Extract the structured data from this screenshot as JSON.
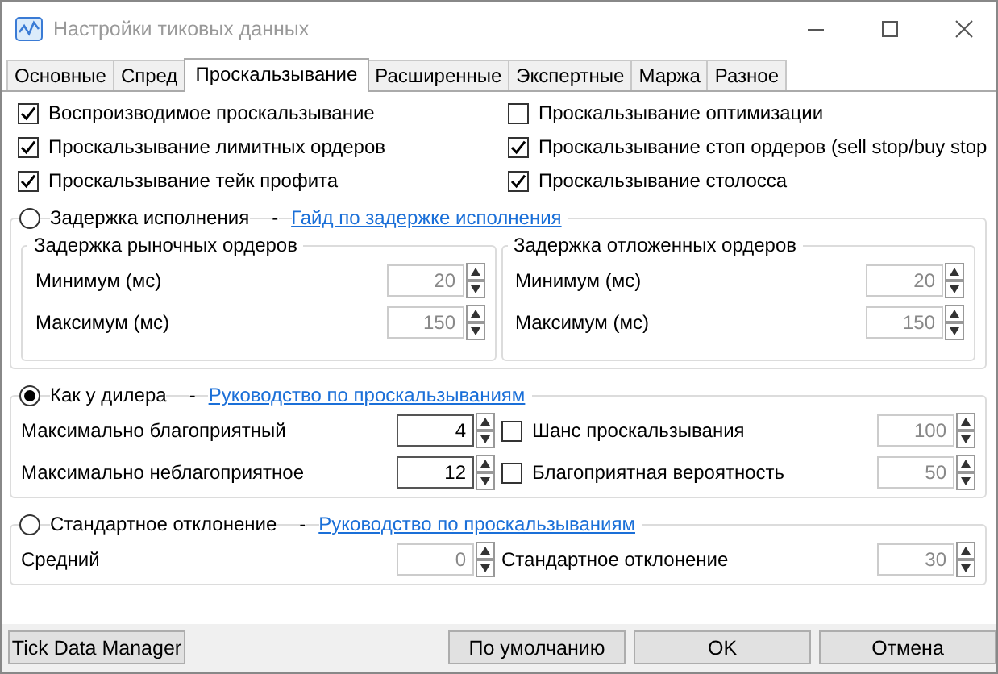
{
  "window": {
    "title": "Настройки тиковых данных"
  },
  "tabs": [
    {
      "label": "Основные",
      "selected": false
    },
    {
      "label": "Спред",
      "selected": false
    },
    {
      "label": "Проскальзывание",
      "selected": true
    },
    {
      "label": "Расширенные",
      "selected": false
    },
    {
      "label": "Экспертные",
      "selected": false
    },
    {
      "label": "Маржа",
      "selected": false
    },
    {
      "label": "Разное",
      "selected": false
    }
  ],
  "options": [
    {
      "label": "Воспроизводимое проскальзывание",
      "checked": true
    },
    {
      "label": "Проскальзывание оптимизации",
      "checked": false
    },
    {
      "label": "Проскальзывание лимитных ордеров",
      "checked": true
    },
    {
      "label": "Проскальзывание стоп ордеров (sell stop/buy stop",
      "checked": true
    },
    {
      "label": "Проскальзывание тейк профита",
      "checked": true
    },
    {
      "label": "Проскальзывание столосса",
      "checked": true
    }
  ],
  "modes": [
    {
      "label": "Задержка исполнения",
      "selected": false,
      "separator": "-",
      "link": "Гайд по задержке исполнения",
      "groups": [
        {
          "title": "Задержка рыночных ордеров",
          "fields": [
            {
              "label": "Минимум (мс)",
              "value": "20",
              "disabled": true
            },
            {
              "label": "Максимум (мс)",
              "value": "150",
              "disabled": true
            }
          ]
        },
        {
          "title": "Задержка отложенных ордеров",
          "fields": [
            {
              "label": "Минимум (мс)",
              "value": "20",
              "disabled": true
            },
            {
              "label": "Максимум (мс)",
              "value": "150",
              "disabled": true
            }
          ]
        }
      ]
    },
    {
      "label": "Как у дилера",
      "selected": true,
      "separator": "-",
      "link": "Руководство по проскальзываниям",
      "fields": [
        {
          "kind": "spin",
          "label": "Максимально благоприятный",
          "value": "4",
          "disabled": false
        },
        {
          "kind": "check",
          "label": "Шанс проскальзывания",
          "checked": false,
          "value": "100",
          "disabled": true
        },
        {
          "kind": "spin",
          "label": "Максимально неблагоприятное",
          "value": "12",
          "disabled": false
        },
        {
          "kind": "check",
          "label": "Благоприятная вероятность",
          "checked": false,
          "value": "50",
          "disabled": true
        }
      ]
    },
    {
      "label": "Стандартное отклонение",
      "selected": false,
      "separator": "-",
      "link": "Руководство по проскальзываниям",
      "fields": [
        {
          "kind": "spin",
          "label": "Средний",
          "value": "0",
          "disabled": true
        },
        {
          "kind": "spin",
          "label": "Стандартное отклонение",
          "value": "30",
          "disabled": true
        }
      ]
    }
  ],
  "buttons": {
    "left": "Tick Data Manager",
    "right": [
      "По умолчанию",
      "OK",
      "Отмена"
    ]
  }
}
